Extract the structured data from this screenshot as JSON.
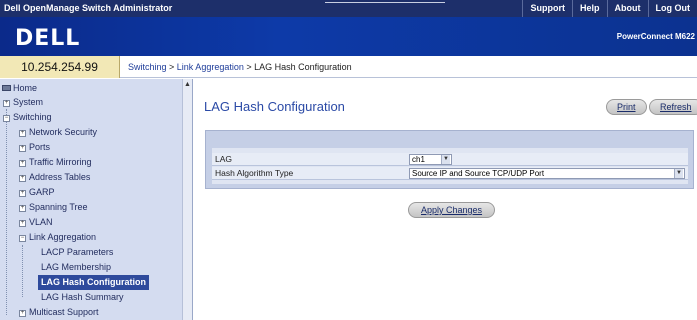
{
  "app": {
    "title": "Dell OpenManage Switch Administrator",
    "top_links": [
      "Support",
      "Help",
      "About",
      "Log Out"
    ],
    "logo": "DELL",
    "product": "PowerConnect M622"
  },
  "address": {
    "ip": "10.254.254.99",
    "breadcrumb": {
      "switching": "Switching",
      "sep1": " > ",
      "link_aggregation": "Link Aggregation",
      "current": " > LAG Hash Configuration"
    }
  },
  "sidebar": {
    "scroll_arrow": "▲",
    "items": [
      {
        "label": "Home"
      },
      {
        "label": "System"
      },
      {
        "label": "Switching"
      },
      {
        "label": "Network Security"
      },
      {
        "label": "Ports"
      },
      {
        "label": "Traffic Mirroring"
      },
      {
        "label": "Address Tables"
      },
      {
        "label": "GARP"
      },
      {
        "label": "Spanning Tree"
      },
      {
        "label": "VLAN"
      },
      {
        "label": "Link Aggregation"
      },
      {
        "label": "LACP Parameters"
      },
      {
        "label": "LAG Membership"
      },
      {
        "label": "LAG Hash Configuration"
      },
      {
        "label": "LAG Hash Summary"
      },
      {
        "label": "Multicast Support"
      }
    ],
    "expand_symbols": {
      "plus": "+",
      "minus": "−"
    }
  },
  "main": {
    "title": "LAG Hash Configuration",
    "print_label": "Print",
    "refresh_label": "Refresh",
    "form": {
      "lag_label": "LAG",
      "lag_value": "ch1",
      "hash_label": "Hash Algorithm Type",
      "hash_value": "Source IP and Source TCP/UDP Port"
    },
    "apply_label": "Apply Changes"
  },
  "colors": {
    "topbar": "#1d2f6a",
    "banner": "#0d3aa8",
    "ip_box": "#f2e8b6",
    "sidebar": "#d4dcf0",
    "selected": "#2e4a9c",
    "title": "#2b4aa6"
  },
  "icons": {
    "home": "home-icon",
    "dropdown": "chevron-down-icon"
  }
}
